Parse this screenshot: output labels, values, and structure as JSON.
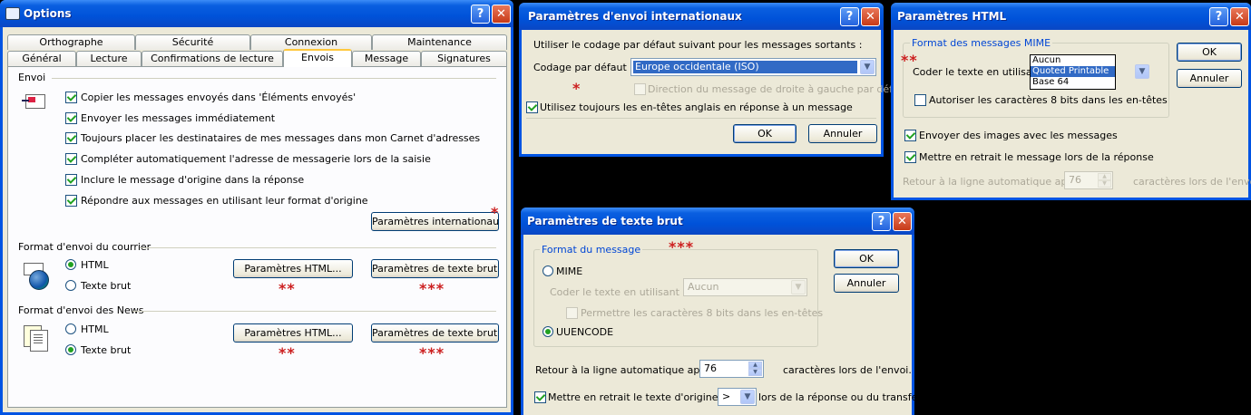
{
  "options": {
    "title": "Options",
    "tabs_row1": [
      "Orthographe",
      "Sécurité",
      "Connexion",
      "Maintenance"
    ],
    "tabs_row2": [
      "Général",
      "Lecture",
      "Confirmations de lecture",
      "Envois",
      "Message",
      "Signatures"
    ],
    "envoi_section": "Envoi",
    "checkboxes": [
      "Copier les messages envoyés dans 'Éléments envoyés'",
      "Envoyer les messages immédiatement",
      "Toujours placer les destinataires de mes messages dans mon Carnet d'adresses",
      "Compléter automatiquement l'adresse de messagerie lors de la saisie",
      "Inclure le message d'origine dans la réponse",
      "Répondre aux messages en utilisant leur format d'origine"
    ],
    "intl_button": "Paramètres internationaux...",
    "mail_format_section": "Format d'envoi du courrier",
    "news_format_section": "Format d'envoi des News",
    "radio_html": "HTML",
    "radio_text": "Texte brut",
    "html_settings_button": "Paramètres HTML...",
    "text_settings_button": "Paramètres de texte brut...",
    "stars_one": "*",
    "stars_two": "**",
    "stars_three": "***"
  },
  "intl": {
    "title": "Paramètres d'envoi internationaux",
    "intro": "Utiliser le codage par défaut suivant pour les messages sortants :",
    "encoding_label": "Codage par défaut :",
    "encoding_value": "Europe occidentale (ISO)",
    "rtl_checkbox": "Direction du message de droite à gauche par défaut",
    "english_headers_checkbox": "Utilisez toujours les en-têtes anglais en réponse à un message",
    "ok": "OK",
    "cancel": "Annuler"
  },
  "html_settings": {
    "title": "Paramètres HTML",
    "mime_group": "Format des messages MIME",
    "encode_label": "Coder le texte en utilisant :",
    "encode_options": [
      "Aucun",
      "Quoted Printable",
      "Base 64"
    ],
    "encode_selected": "Quoted Printable",
    "allow8bit": "Autoriser les caractères 8 bits dans les en-têtes",
    "send_images": "Envoyer des images avec les messages",
    "indent_reply": "Mettre en retrait le message lors de la réponse",
    "wrap_label": "Retour à la ligne automatique après",
    "wrap_value": "76",
    "wrap_suffix": "caractères lors de l'envoi.",
    "ok": "OK",
    "cancel": "Annuler"
  },
  "text_settings": {
    "title": "Paramètres de texte brut",
    "group": "Format du message",
    "mime": "MIME",
    "encode_label": "Coder le texte en utilisant :",
    "encode_value": "Aucun",
    "allow8bit": "Permettre les caractères 8 bits dans les en-têtes",
    "uuencode": "UUENCODE",
    "wrap_label": "Retour à la ligne automatique après",
    "wrap_value": "76",
    "wrap_suffix": "caractères lors de l'envoi.",
    "indent_label": "Mettre en retrait le texte d'origine avec",
    "indent_value": ">",
    "indent_suffix": "lors de la réponse ou du transfert.",
    "ok": "OK",
    "cancel": "Annuler"
  }
}
